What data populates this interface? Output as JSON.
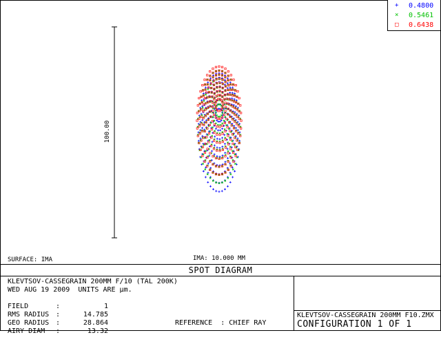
{
  "legend": [
    {
      "marker": "+",
      "wavelength": "0.4800",
      "color": "#0000ff"
    },
    {
      "marker": "×",
      "wavelength": "0.5461",
      "color": "#00c000"
    },
    {
      "marker": "□",
      "wavelength": "0.6438",
      "color": "#ff0000"
    }
  ],
  "scale_bar_label": "100.00",
  "surface_label": "SURFACE: IMA",
  "ima_label": "IMA: 10.000 MM",
  "title": "SPOT DIAGRAM",
  "info": {
    "system": "KLEVTSOV-CASSEGRAIN 200MM F/10 (TAL 200K)",
    "date_units": "WED AUG 19 2009  UNITS ARE µm.",
    "field_label": "FIELD",
    "field_value": "1",
    "rms_label": "RMS RADIUS",
    "rms_value": "14.785",
    "geo_label": "GEO RADIUS",
    "geo_value": "28.864",
    "airy_label": "AIRY DIAM",
    "airy_value": "13.32",
    "reference": "REFERENCE  : CHIEF RAY"
  },
  "file_name": "KLEVTSOV-CASSEGRAIN 200MM F10.ZMX",
  "configuration": "CONFIGURATION  1 OF  1"
}
